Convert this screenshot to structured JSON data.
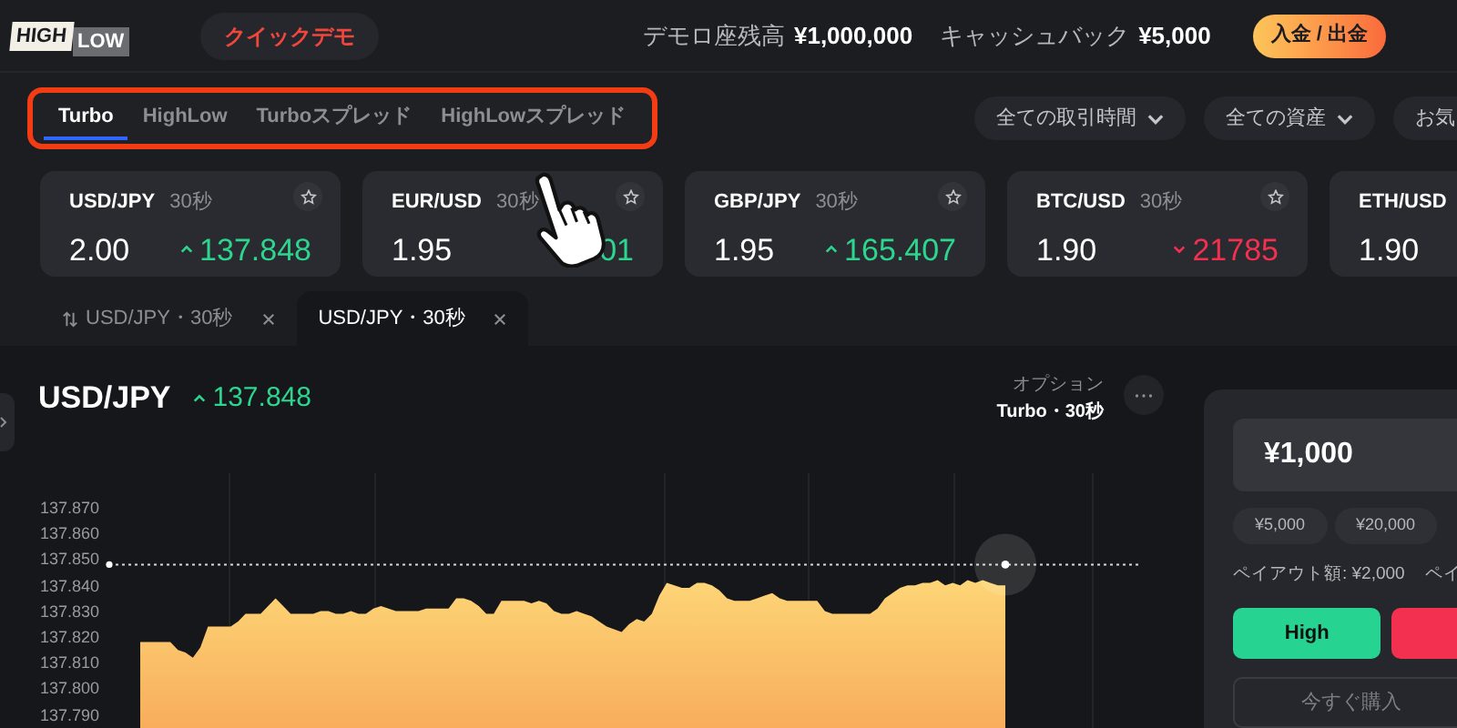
{
  "header": {
    "logo": {
      "word_1": "HIGH",
      "word_2": "LOW"
    },
    "demo_badge": "クイックデモ",
    "balance_label": "デモロ座残高",
    "balance": "¥1,000,000",
    "cashback_label": "キャッシュバック",
    "cashback": "¥5,000",
    "deposit_button": "入金 / 出金"
  },
  "option_tabs": [
    {
      "label": "Turbo",
      "selected": true
    },
    {
      "label": "HighLow",
      "selected": false
    },
    {
      "label": "Turboスプレッド",
      "selected": false
    },
    {
      "label": "HighLowスプレッド",
      "selected": false
    }
  ],
  "filters": [
    "全ての取引時間",
    "全ての資産",
    "お気"
  ],
  "asset_cards": [
    {
      "pair": "USD/JPY",
      "duration": "30秒",
      "payout": "2.00",
      "price": "137.848",
      "rising": true
    },
    {
      "pair": "EUR/USD",
      "duration": "30秒",
      "payout": "1.95",
      "price": "01"
    },
    {
      "pair": "GBP/JPY",
      "duration": "30秒",
      "payout": "1.95",
      "price": "165.407",
      "rising": true
    },
    {
      "pair": "BTC/USD",
      "duration": "30秒",
      "payout": "1.90",
      "price": "21785",
      "rising": false
    },
    {
      "pair": "ETH/USD",
      "payout": "1.90"
    }
  ],
  "chart_tabs": [
    {
      "label": "USD/JPY・30秒",
      "selected": false
    },
    {
      "label": "USD/JPY・30秒",
      "selected": true
    }
  ],
  "chart": {
    "pair": "USD/JPY",
    "price": "137.848",
    "rising": true,
    "option_label": "オプション",
    "option_value": "Turbo・30秒",
    "y_labels": [
      "137.870",
      "137.860",
      "137.850",
      "137.840",
      "137.830",
      "137.820",
      "137.810",
      "137.800",
      "137.790"
    ]
  },
  "trade_panel": {
    "amount": "¥1,000",
    "presets": [
      "¥5,000",
      "¥20,000"
    ],
    "payouts": [
      "ペイアウト額: ¥2,000",
      "ペイ"
    ],
    "high_button": "High",
    "buy_button": "今すぐ購入"
  }
}
